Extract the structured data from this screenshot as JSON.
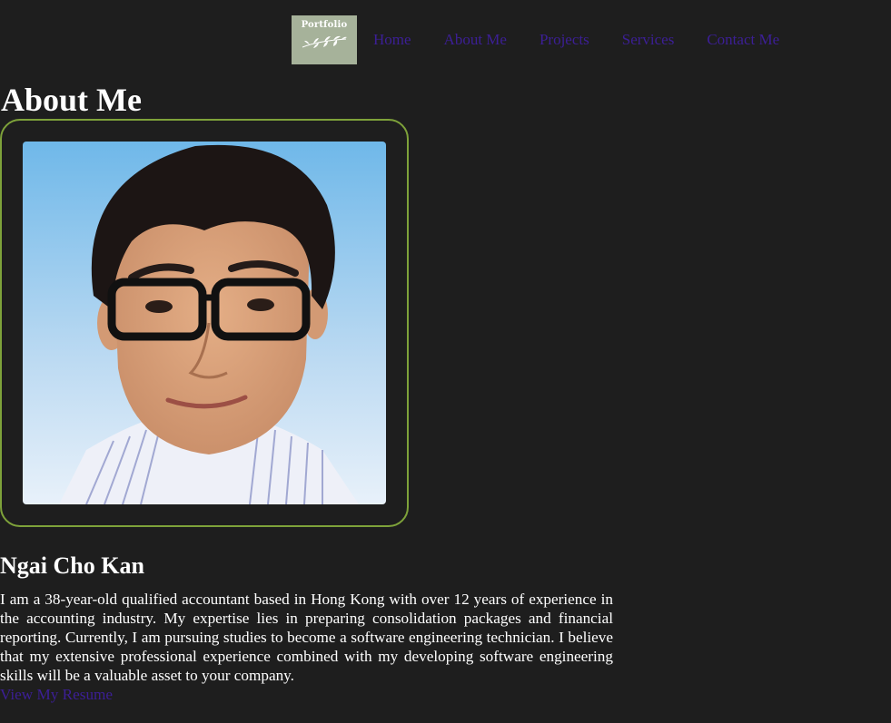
{
  "nav": {
    "logo_text": "Portfolio",
    "links": [
      {
        "label": "Home"
      },
      {
        "label": "About Me"
      },
      {
        "label": "Projects"
      },
      {
        "label": "Services"
      },
      {
        "label": "Contact Me"
      }
    ]
  },
  "about": {
    "title": "About Me",
    "name": "Ngai Cho Kan",
    "bio": "I am a 38-year-old qualified accountant based in Hong Kong with over 12 years of experience in the accounting industry. My expertise lies in preparing consolidation packages and financial reporting. Currently, I am pursuing studies to become a software engineering technician. I believe that my extensive professional experience combined with my developing software engineering skills will be a valuable asset to your company.",
    "resume_link": "View My Resume"
  },
  "colors": {
    "background": "#1e1e1e",
    "link": "#3c1f96",
    "frame_border": "#7ea23a",
    "logo_bg": "#a6b29a"
  },
  "icons": [
    "leaf-branch-icon"
  ]
}
